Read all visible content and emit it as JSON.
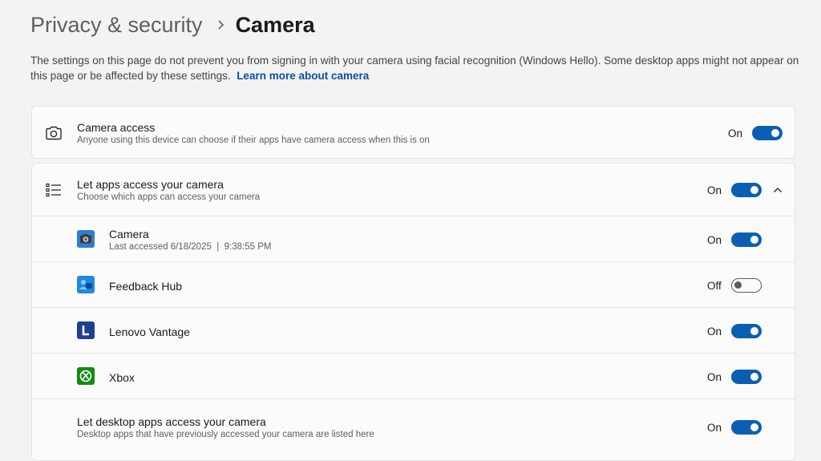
{
  "breadcrumb": {
    "parent": "Privacy & security",
    "current": "Camera"
  },
  "description": {
    "text": "The settings on this page do not prevent you from signing in with your camera using facial recognition (Windows Hello). Some desktop apps might not appear on this page or be affected by these settings.",
    "link": "Learn more about camera"
  },
  "camera_access": {
    "title": "Camera access",
    "subtitle": "Anyone using this device can choose if their apps have camera access when this is on",
    "state": "On",
    "enabled": true
  },
  "apps_access": {
    "title": "Let apps access your camera",
    "subtitle": "Choose which apps can access your camera",
    "state": "On",
    "enabled": true,
    "expanded": true
  },
  "apps": [
    {
      "name": "Camera",
      "detail": "Last accessed 6/18/2025  |  9:38:55 PM",
      "state": "On",
      "enabled": true,
      "icon": "camera-app-icon"
    },
    {
      "name": "Feedback Hub",
      "detail": "",
      "state": "Off",
      "enabled": false,
      "icon": "feedback-hub-icon"
    },
    {
      "name": "Lenovo Vantage",
      "detail": "",
      "state": "On",
      "enabled": true,
      "icon": "lenovo-vantage-icon"
    },
    {
      "name": "Xbox",
      "detail": "",
      "state": "On",
      "enabled": true,
      "icon": "xbox-icon"
    }
  ],
  "desktop_apps": {
    "title": "Let desktop apps access your camera",
    "subtitle": "Desktop apps that have previously accessed your camera are listed here",
    "state": "On",
    "enabled": true
  },
  "colors": {
    "accent": "#0a5fb4",
    "link": "#0a4fa6",
    "background": "#f3f3f3",
    "card": "#fbfbfb"
  }
}
